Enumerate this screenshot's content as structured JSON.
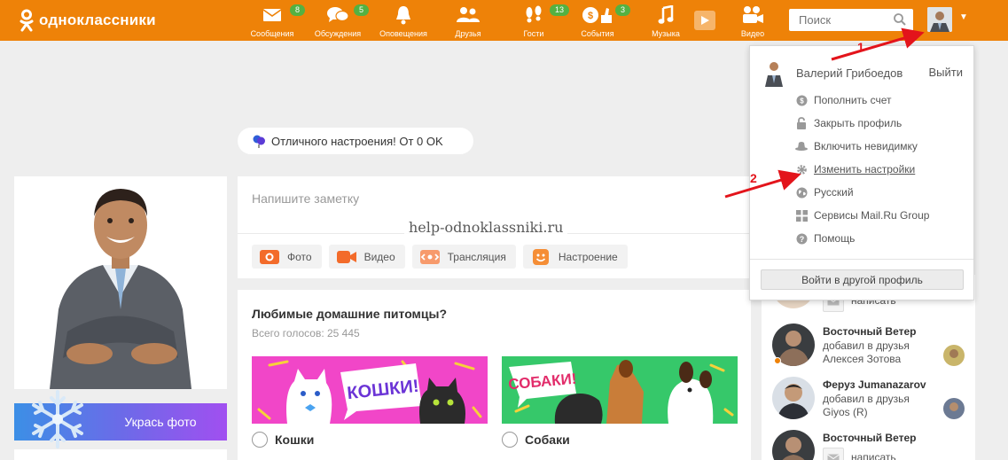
{
  "brand": {
    "name": "одноклассники",
    "accent": "#ee8208",
    "badge_color": "#54b142"
  },
  "nav": [
    {
      "label": "Сообщения",
      "icon": "envelope-icon",
      "badge": "8"
    },
    {
      "label": "Обсуждения",
      "icon": "chat-bubbles-icon",
      "badge": "5"
    },
    {
      "label": "Оповещения",
      "icon": "bell-icon",
      "badge": ""
    },
    {
      "label": "Друзья",
      "icon": "friends-icon",
      "badge": ""
    },
    {
      "label": "Гости",
      "icon": "footprints-icon",
      "badge": "13"
    },
    {
      "label": "События",
      "icon": "events-icon",
      "badge": "3"
    },
    {
      "label": "Музыка",
      "icon": "music-note-icon",
      "badge": ""
    },
    {
      "label": "Видео",
      "icon": "video-camera-icon",
      "badge": ""
    }
  ],
  "search": {
    "placeholder": "Поиск"
  },
  "mood": {
    "text": "Отличного настроения! От 0 OK"
  },
  "profile": {
    "decorate_label": "Укрась фото"
  },
  "note": {
    "placeholder": "Напишите заметку",
    "actions": [
      {
        "label": "Фото",
        "icon": "camera-icon"
      },
      {
        "label": "Видео",
        "icon": "video-camera-icon"
      },
      {
        "label": "Трансляция",
        "icon": "broadcast-icon"
      },
      {
        "label": "Настроение",
        "icon": "smiley-icon"
      }
    ]
  },
  "watermark": "help-odnoklassniki.ru",
  "poll": {
    "question": "Любимые домашние питомцы?",
    "total_votes": "Всего голосов: 25 445",
    "options": [
      {
        "label": "Кошки",
        "image_text": "КОШКИ!"
      },
      {
        "label": "Собаки",
        "image_text": "СОБАКИ!"
      }
    ]
  },
  "feed": [
    {
      "name": "",
      "line1": "написать",
      "line2": ""
    },
    {
      "name": "Восточный Ветер",
      "line1": "добавил в друзья",
      "line2": "Алексея Зотова"
    },
    {
      "name": "Феруз Jumanazarov",
      "line1": "добавил в друзья",
      "line2": "Giyos (R)"
    },
    {
      "name": "Восточный Ветер",
      "line1": "написать",
      "line2": ""
    }
  ],
  "dropdown": {
    "user_name": "Валерий Грибоедов",
    "logout": "Выйти",
    "items": [
      {
        "label": "Пополнить счет",
        "icon": "coin-icon"
      },
      {
        "label": "Закрыть профиль",
        "icon": "lock-icon"
      },
      {
        "label": "Включить невидимку",
        "icon": "hat-icon"
      },
      {
        "label": "Изменить настройки",
        "icon": "gear-icon"
      },
      {
        "label": "Русский",
        "icon": "globe-icon"
      },
      {
        "label": "Сервисы Mail.Ru Group",
        "icon": "grid-icon"
      },
      {
        "label": "Помощь",
        "icon": "help-icon"
      }
    ],
    "switch_profile": "Войти в другой профиль"
  },
  "annotations": {
    "arrow1": "1",
    "arrow2": "2",
    "color": "#e3141b"
  }
}
